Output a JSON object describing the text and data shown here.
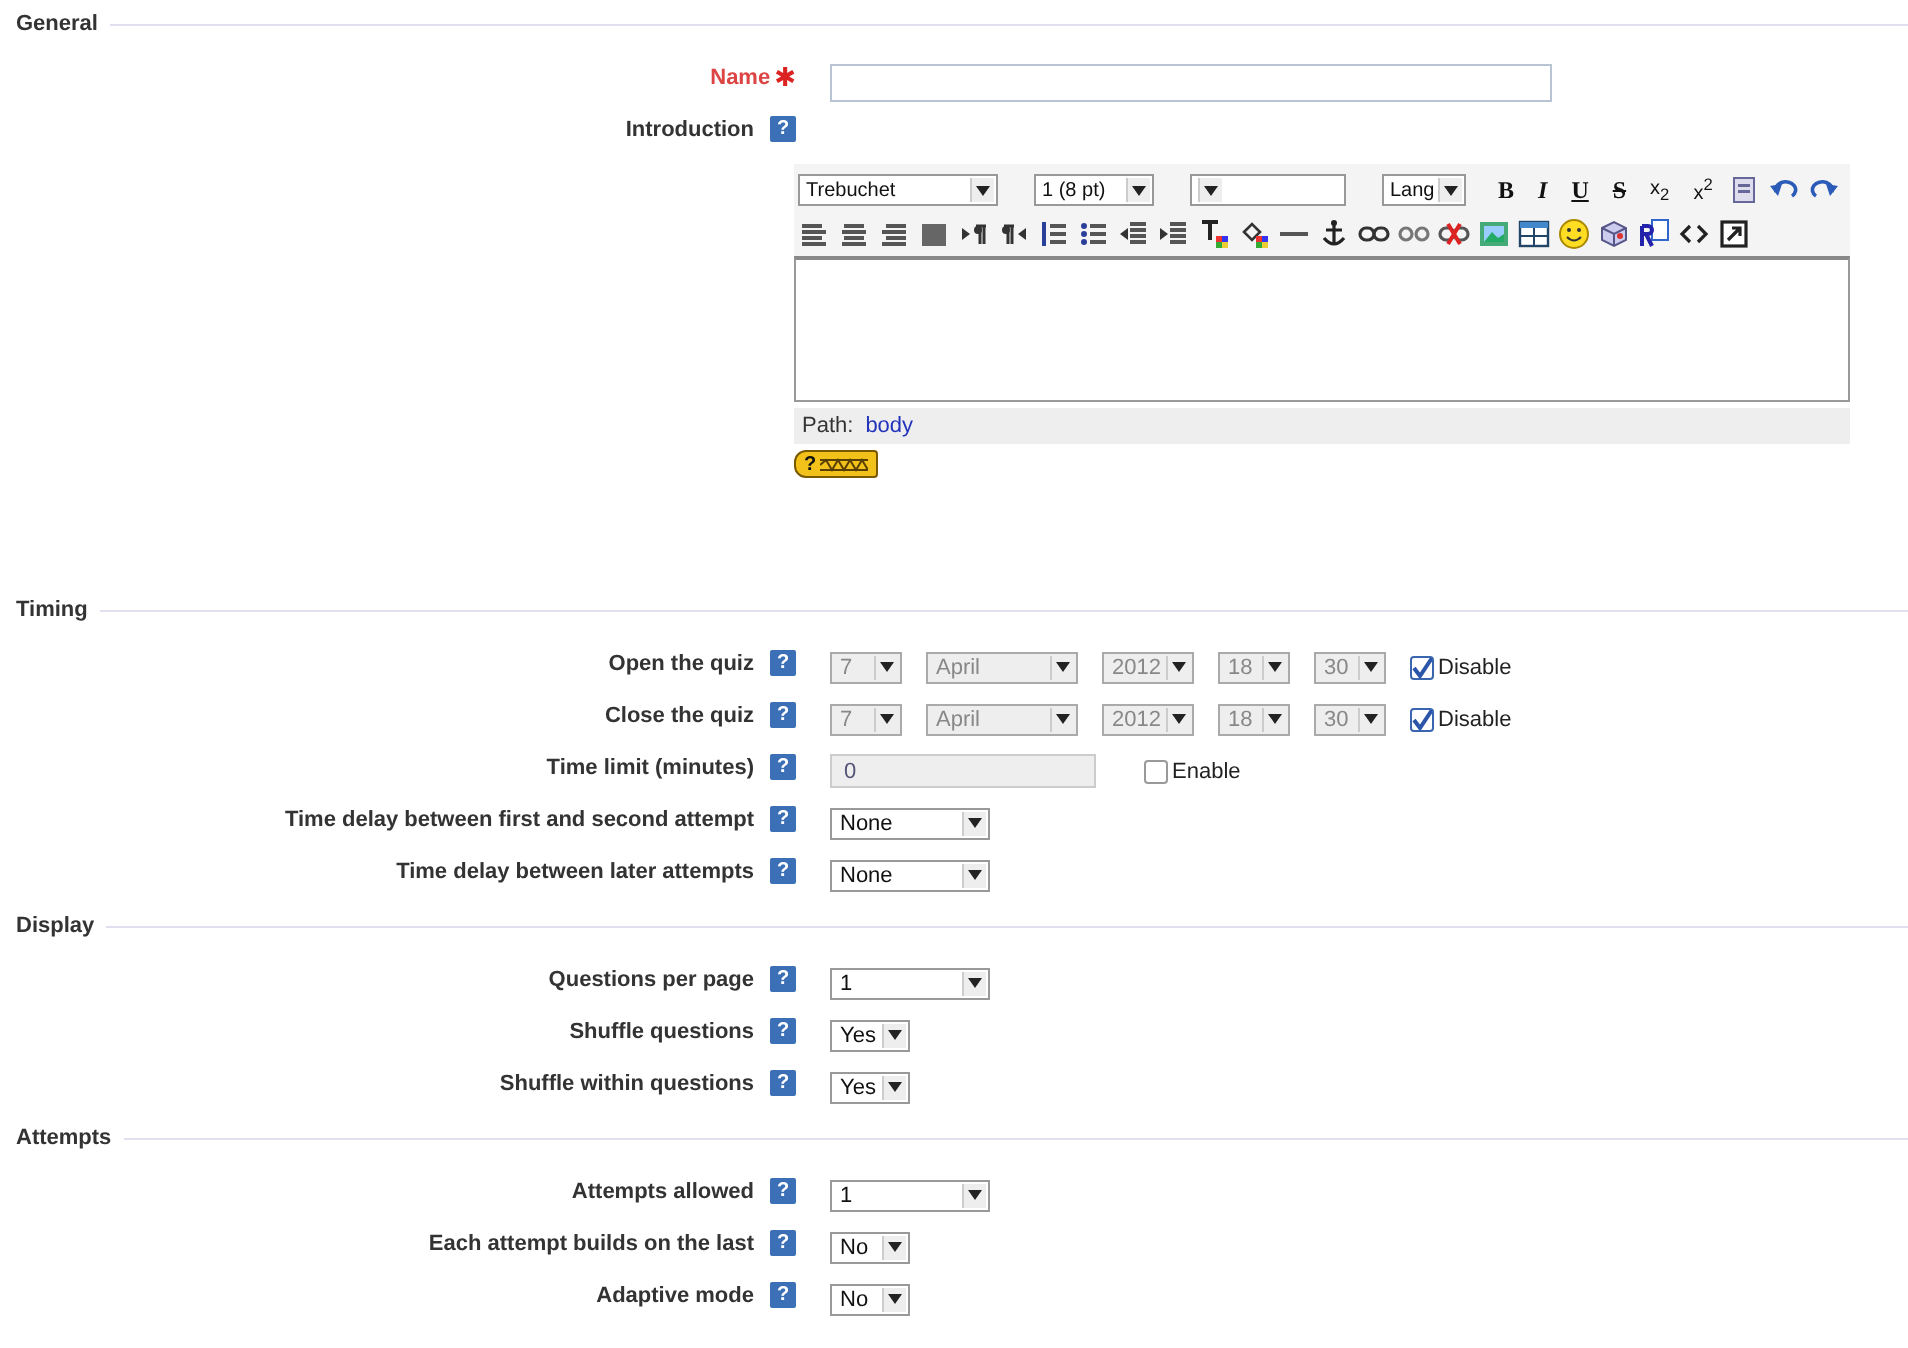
{
  "sections": [
    {
      "title": "General",
      "fields": [
        {
          "kind": "text",
          "label": "Name",
          "required": "✱"
        },
        {
          "kind": "editor",
          "label": "Introduction",
          "help": "?",
          "editor": {
            "selects": [
              {
                "value": "Trebuchet",
                "kind": "font"
              },
              {
                "value": "1 (8 pt)",
                "kind": "size"
              },
              {
                "kind": "format"
              },
              {
                "value": "Lang",
                "kind": "lang"
              }
            ],
            "format_buttons": [
              {
                "label": "B",
                "kind": "bold"
              },
              {
                "label": "I",
                "kind": "italic"
              },
              {
                "label": "U",
                "kind": "underline"
              },
              {
                "label": "S",
                "kind": "strike"
              },
              {
                "label": "x$_{2}$",
                "kind": "sub"
              },
              {
                "label": "x$^{2}$",
                "kind": "sup"
              }
            ],
            "row1_icons": [
              {
                "kind": "paste-word"
              },
              {
                "kind": "undo"
              },
              {
                "kind": "redo"
              }
            ],
            "row2_icons": [
              {
                "kind": "align-left"
              },
              {
                "kind": "align-center"
              },
              {
                "kind": "align-right"
              },
              {
                "kind": "justify"
              },
              {
                "kind": "ltr"
              },
              {
                "kind": "rtl"
              },
              {
                "kind": "ordered-list"
              },
              {
                "kind": "bullet-list"
              },
              {
                "kind": "outdent"
              },
              {
                "kind": "indent"
              },
              {
                "kind": "text-color"
              },
              {
                "kind": "bg-color"
              },
              {
                "kind": "rule"
              },
              {
                "kind": "anchor"
              },
              {
                "kind": "link"
              },
              {
                "kind": "unlink"
              },
              {
                "kind": "nolink"
              },
              {
                "kind": "image"
              },
              {
                "kind": "table"
              },
              {
                "kind": "smiley"
              },
              {
                "kind": "cube"
              },
              {
                "kind": "replace"
              },
              {
                "kind": "source"
              },
              {
                "kind": "fullscreen"
              }
            ],
            "path_label": "Path:",
            "path_link": "body",
            "help_button": "?"
          }
        }
      ]
    },
    {
      "title": "Timing",
      "fields": [
        {
          "kind": "datetime",
          "label": "Open the quiz",
          "help": "?",
          "parts": [
            "7",
            "April",
            "2012",
            "18",
            "30"
          ],
          "disabled": true,
          "checkbox": {
            "label": "Disable",
            "checked": true
          }
        },
        {
          "kind": "datetime",
          "label": "Close the quiz",
          "help": "?",
          "parts": [
            "7",
            "April",
            "2012",
            "18",
            "30"
          ],
          "disabled": true,
          "checkbox": {
            "label": "Disable",
            "checked": true
          }
        },
        {
          "kind": "number",
          "label": "Time limit (minutes)",
          "help": "?",
          "value": "0",
          "disabled": true,
          "checkbox": {
            "label": "Enable",
            "checked": false
          }
        },
        {
          "kind": "dropdown",
          "label": "Time delay between first and second attempt",
          "help": "?",
          "value": "None"
        },
        {
          "kind": "dropdown",
          "label": "Time delay between later attempts",
          "help": "?",
          "value": "None"
        }
      ]
    },
    {
      "title": "Display",
      "fields": [
        {
          "kind": "dropdown",
          "label": "Questions per page",
          "help": "?",
          "value": "1"
        },
        {
          "kind": "short-dropdown",
          "label": "Shuffle questions",
          "help": "?",
          "value": "Yes"
        },
        {
          "kind": "short-dropdown",
          "label": "Shuffle within questions",
          "help": "?",
          "value": "Yes"
        }
      ]
    },
    {
      "title": "Attempts",
      "fields": [
        {
          "kind": "dropdown",
          "label": "Attempts allowed",
          "help": "?",
          "value": "1"
        },
        {
          "kind": "short-dropdown",
          "label": "Each attempt builds on the last",
          "help": "?",
          "value": "No"
        },
        {
          "kind": "short-dropdown",
          "label": "Adaptive mode",
          "help": "?",
          "value": "No"
        }
      ]
    }
  ]
}
